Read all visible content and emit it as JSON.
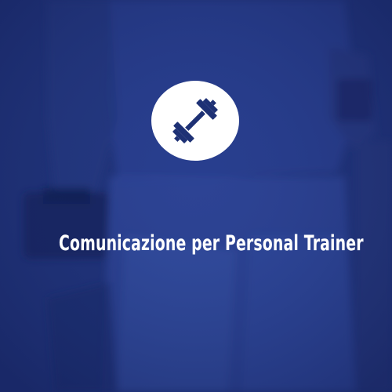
{
  "card": {
    "title": "Comunicazione per Personal Trainer",
    "icon": "dumbbell-icon",
    "overlay_color": "#1e3175",
    "icon_bg_color": "#ffffff",
    "icon_color": "#1e3175"
  }
}
